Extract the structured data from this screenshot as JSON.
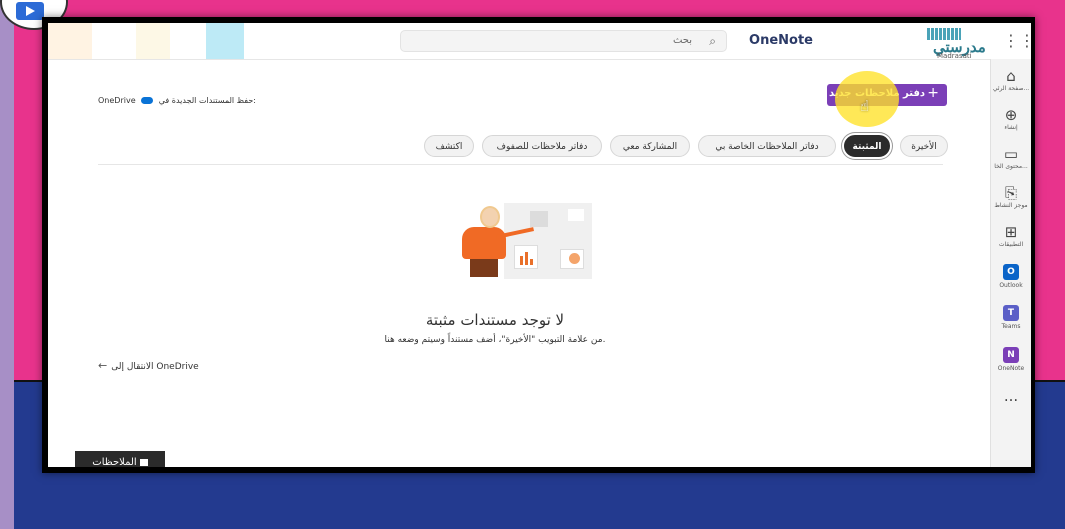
{
  "app": {
    "brand_arabic": "مدرستي",
    "brand_latin": "Madrasati",
    "title": "OneNote",
    "search_placeholder": "بحث"
  },
  "rail": {
    "items": [
      {
        "icon": "home-icon",
        "label": "صفحة الرئي..."
      },
      {
        "icon": "plus-circle-icon",
        "label": "إنشاء"
      },
      {
        "icon": "folder-icon",
        "label": "محتوى الخا..."
      },
      {
        "icon": "activity-icon",
        "label": "موجز النشاط"
      },
      {
        "icon": "apps-icon",
        "label": "التطبيقات"
      },
      {
        "icon": "outlook-icon",
        "label": "Outlook"
      },
      {
        "icon": "teams-icon",
        "label": "Teams"
      },
      {
        "icon": "onenote-icon",
        "label": "OneNote"
      },
      {
        "icon": "more-icon",
        "label": "..."
      }
    ],
    "tile_colors": {
      "outlook": "#0a64c8",
      "teams": "#5b5fc7",
      "onenote": "#7b3fb7"
    }
  },
  "content": {
    "save_label": "حفظ المستندات الجديدة في:",
    "save_location": "OneDrive",
    "new_notebook_label": "دفتر ملاحظات جديد",
    "tabs": [
      {
        "label": "الأخيرة",
        "active": false
      },
      {
        "label": "المثبتة",
        "active": true
      },
      {
        "label": "دفاتر الملاحظات الخاصة بي",
        "active": false
      },
      {
        "label": "المشاركة معي",
        "active": false
      },
      {
        "label": "دفاتر ملاحظات للصفوف",
        "active": false
      },
      {
        "label": "اكتشف",
        "active": false
      }
    ],
    "empty_title": "لا توجد مستندات مثبتة",
    "empty_subtitle": "من علامة التبويب \"الأخيرة\"، أضف مستنداً وسيتم وضعه هنا.",
    "goto_onedrive": "الانتقال إلى OneDrive",
    "notes_button": "الملاحظات"
  },
  "colors": {
    "accent": "#7b3fb7",
    "background_pink": "#e8338c",
    "background_blue": "#233a8f"
  }
}
